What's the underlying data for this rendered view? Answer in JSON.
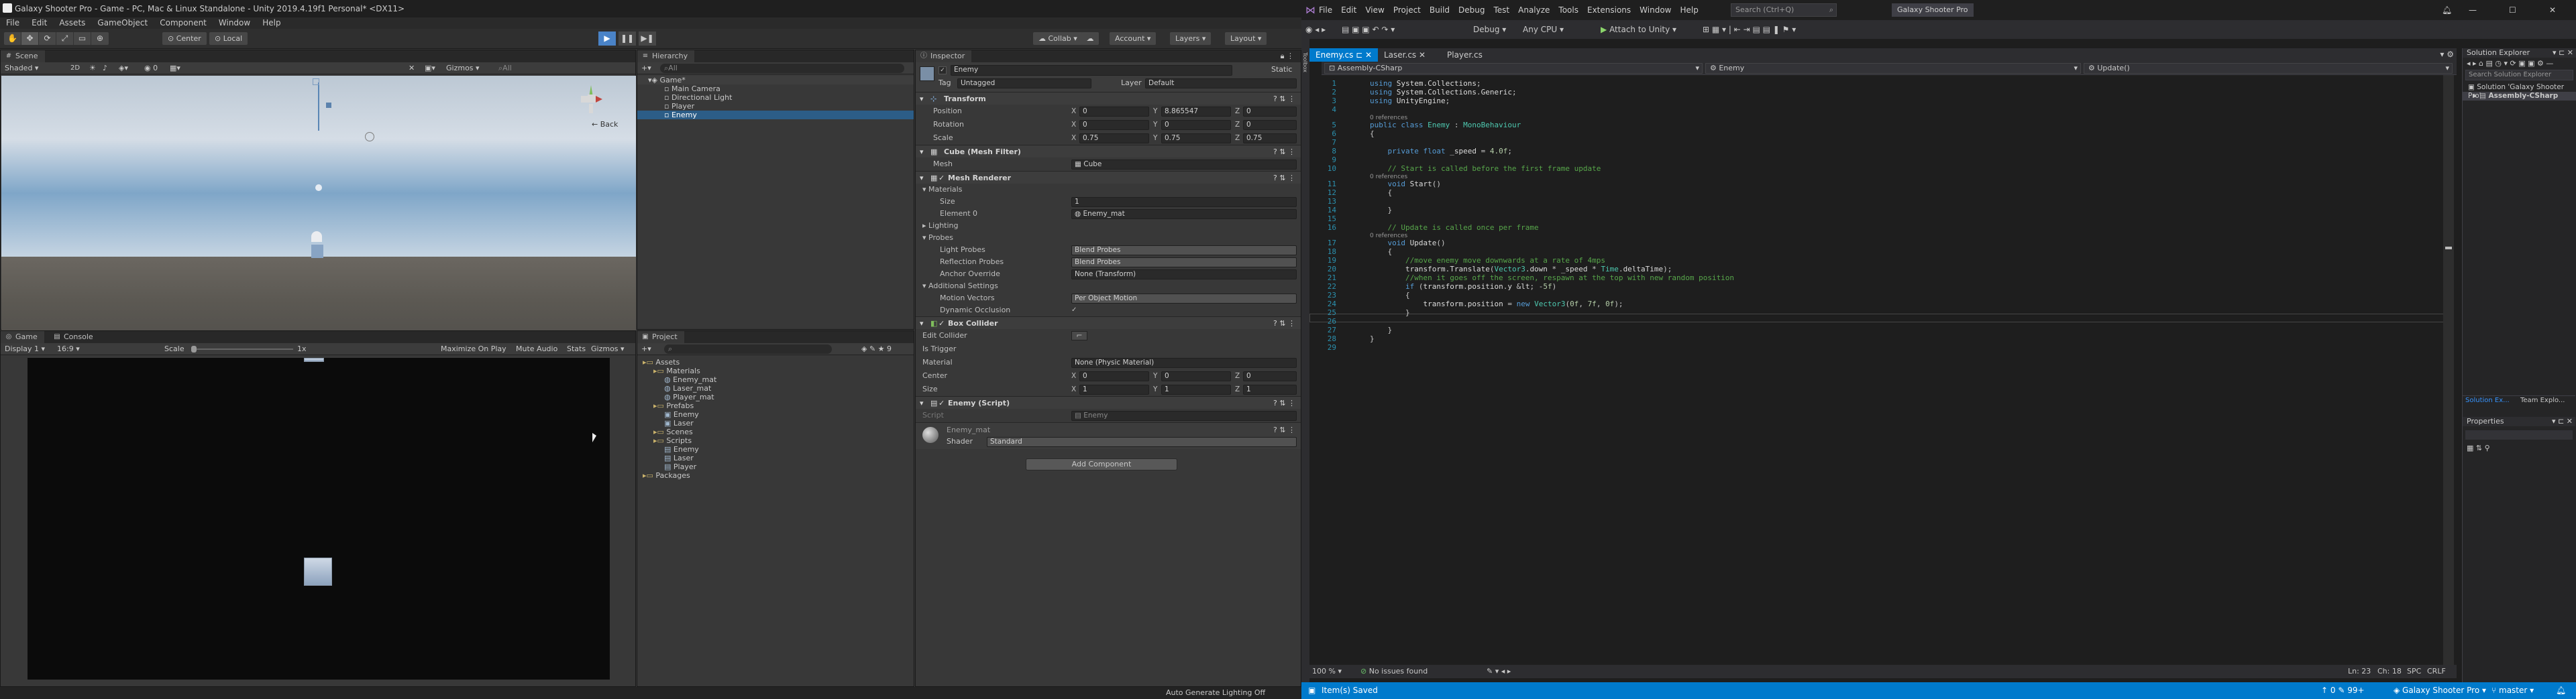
{
  "unity": {
    "title": "Galaxy Shooter Pro - Game - PC, Mac & Linux Standalone - Unity 2019.4.19f1 Personal* <DX11>",
    "menu": [
      "File",
      "Edit",
      "Assets",
      "GameObject",
      "Component",
      "Window",
      "Help"
    ],
    "toolbar": {
      "pivot": "Center",
      "space": "Local",
      "collab": "Collab",
      "account": "Account",
      "layers": "Layers",
      "layout": "Layout"
    },
    "scene": {
      "tab": "Scene",
      "shading": "Shaded",
      "mode_2d": "2D",
      "gizmos": "Gizmos",
      "search": "All",
      "back_label": "← Back"
    },
    "game": {
      "tab": "Game",
      "console_tab": "Console",
      "display": "Display 1",
      "aspect": "16:9",
      "scale_label": "Scale",
      "scale_value": "1x",
      "maximize": "Maximize On Play",
      "mute": "Mute Audio",
      "stats": "Stats",
      "gizmos": "Gizmos"
    },
    "hierarchy": {
      "tab": "Hierarchy",
      "create": "+",
      "search": "All",
      "items": [
        {
          "label": "Game*",
          "indent": 0
        },
        {
          "label": "Main Camera",
          "indent": 1
        },
        {
          "label": "Directional Light",
          "indent": 1
        },
        {
          "label": "Player",
          "indent": 1
        },
        {
          "label": "Enemy",
          "indent": 1
        }
      ]
    },
    "project": {
      "tab": "Project",
      "create": "+",
      "items": [
        {
          "label": "Assets",
          "indent": 0,
          "kind": "folder"
        },
        {
          "label": "Materials",
          "indent": 1,
          "kind": "folder"
        },
        {
          "label": "Enemy_mat",
          "indent": 2,
          "kind": "mat"
        },
        {
          "label": "Laser_mat",
          "indent": 2,
          "kind": "mat"
        },
        {
          "label": "Player_mat",
          "indent": 2,
          "kind": "mat"
        },
        {
          "label": "Prefabs",
          "indent": 1,
          "kind": "folder"
        },
        {
          "label": "Enemy",
          "indent": 2,
          "kind": "prefab"
        },
        {
          "label": "Laser",
          "indent": 2,
          "kind": "prefab"
        },
        {
          "label": "Scenes",
          "indent": 1,
          "kind": "folder"
        },
        {
          "label": "Scripts",
          "indent": 1,
          "kind": "folder"
        },
        {
          "label": "Enemy",
          "indent": 2,
          "kind": "script"
        },
        {
          "label": "Laser",
          "indent": 2,
          "kind": "script"
        },
        {
          "label": "Player",
          "indent": 2,
          "kind": "script"
        },
        {
          "label": "Packages",
          "indent": 0,
          "kind": "folder"
        }
      ]
    },
    "inspector": {
      "tab": "Inspector",
      "name": "Enemy",
      "static": "Static",
      "tag_label": "Tag",
      "tag": "Untagged",
      "layer_label": "Layer",
      "layer": "Default",
      "transform": "Transform",
      "position": "Position",
      "rotation": "Rotation",
      "scale": "Scale",
      "pos": [
        "0",
        "8.865547",
        "0"
      ],
      "rot": [
        "0",
        "0",
        "0"
      ],
      "scl": [
        "0.75",
        "0.75",
        "0.75"
      ],
      "mesh_filter": "Cube (Mesh Filter)",
      "mesh_label": "Mesh",
      "mesh": "Cube",
      "mesh_renderer": "Mesh Renderer",
      "materials": "Materials",
      "size_label": "Size",
      "size": "1",
      "element0_label": "Element 0",
      "element0": "Enemy_mat",
      "lighting": "Lighting",
      "probes": "Probes",
      "light_probes_label": "Light Probes",
      "light_probes": "Blend Probes",
      "refl_probes_label": "Reflection Probes",
      "refl_probes": "Blend Probes",
      "anchor_label": "Anchor Override",
      "anchor": "None (Transform)",
      "additional": "Additional Settings",
      "motion_label": "Motion Vectors",
      "motion": "Per Object Motion",
      "dyn_occ": "Dynamic Occlusion",
      "box_collider": "Box Collider",
      "edit_collider": "Edit Collider",
      "is_trigger": "Is Trigger",
      "material_label": "Material",
      "material": "None (Physic Material)",
      "center_label": "Center",
      "center": [
        "0",
        "0",
        "0"
      ],
      "bsize": [
        "1",
        "1",
        "1"
      ],
      "script_comp": "Enemy (Script)",
      "script_label": "Script",
      "script": "Enemy",
      "mat_name": "Enemy_mat",
      "shader_label": "Shader",
      "shader": "Standard",
      "add_component": "Add Component"
    },
    "status": "Auto Generate Lighting Off"
  },
  "vs": {
    "menu": [
      "File",
      "Edit",
      "View",
      "Project",
      "Build",
      "Debug",
      "Test",
      "Analyze",
      "Tools",
      "Extensions",
      "Window",
      "Help"
    ],
    "search": "Search (Ctrl+Q)",
    "solution_title": "Galaxy Shooter Pro",
    "config": "Debug",
    "platform": "Any CPU",
    "attach": "Attach to Unity",
    "tabs": [
      "Enemy.cs",
      "Laser.cs",
      "Player.cs"
    ],
    "nav": {
      "project": "Assembly-CSharp",
      "class": "Enemy",
      "member": "Update()"
    },
    "zoom": "100 %",
    "issues": "No issues found",
    "ln": "Ln: 23",
    "ch": "Ch: 18",
    "spc": "SPC",
    "crlf": "CRLF",
    "status_left": "Item(s) Saved",
    "status_right": "Galaxy Shooter Pro",
    "branch": "master",
    "side": {
      "solution_explorer": "Solution Explorer",
      "search": "Search Solution Explorer",
      "solution": "Solution 'Galaxy Shooter Pro'",
      "project": "Assembly-CSharp",
      "tab1": "Solution Ex...",
      "tab2": "Team Explo...",
      "properties": "Properties"
    },
    "code": [
      {
        "n": "1",
        "t": "using System.Collections;"
      },
      {
        "n": "2",
        "t": "using System.Collections.Generic;"
      },
      {
        "n": "3",
        "t": "using UnityEngine;"
      },
      {
        "n": "4",
        "t": ""
      },
      {
        "ref": "0 references"
      },
      {
        "n": "5",
        "t": "public class Enemy : MonoBehaviour"
      },
      {
        "n": "6",
        "t": "{"
      },
      {
        "n": "7",
        "t": ""
      },
      {
        "n": "8",
        "t": "    private float _speed = 4.0f;"
      },
      {
        "n": "9",
        "t": ""
      },
      {
        "n": "10",
        "t": "    // Start is called before the first frame update"
      },
      {
        "ref": "0 references"
      },
      {
        "n": "11",
        "t": "    void Start()"
      },
      {
        "n": "12",
        "t": "    {"
      },
      {
        "n": "13",
        "t": ""
      },
      {
        "n": "14",
        "t": "    }"
      },
      {
        "n": "15",
        "t": ""
      },
      {
        "n": "16",
        "t": "    // Update is called once per frame"
      },
      {
        "ref": "0 references"
      },
      {
        "n": "17",
        "t": "    void Update()"
      },
      {
        "n": "18",
        "t": "    {"
      },
      {
        "n": "19",
        "t": "        //move enemy move downwards at a rate of 4mps"
      },
      {
        "n": "20",
        "t": "        transform.Translate(Vector3.down * _speed * Time.deltaTime);"
      },
      {
        "n": "21",
        "t": "        //when it goes off the screen, respawn at the top with new random position"
      },
      {
        "n": "22",
        "t": "        if (transform.position.y < -5f)"
      },
      {
        "n": "23",
        "t": "        {"
      },
      {
        "n": "24",
        "t": "            transform.position = new Vector3(0f, 7f, 0f);"
      },
      {
        "n": "25",
        "t": "        }"
      },
      {
        "n": "26",
        "t": ""
      },
      {
        "n": "27",
        "t": "    }"
      },
      {
        "n": "28",
        "t": "}"
      },
      {
        "n": "29",
        "t": ""
      }
    ]
  }
}
